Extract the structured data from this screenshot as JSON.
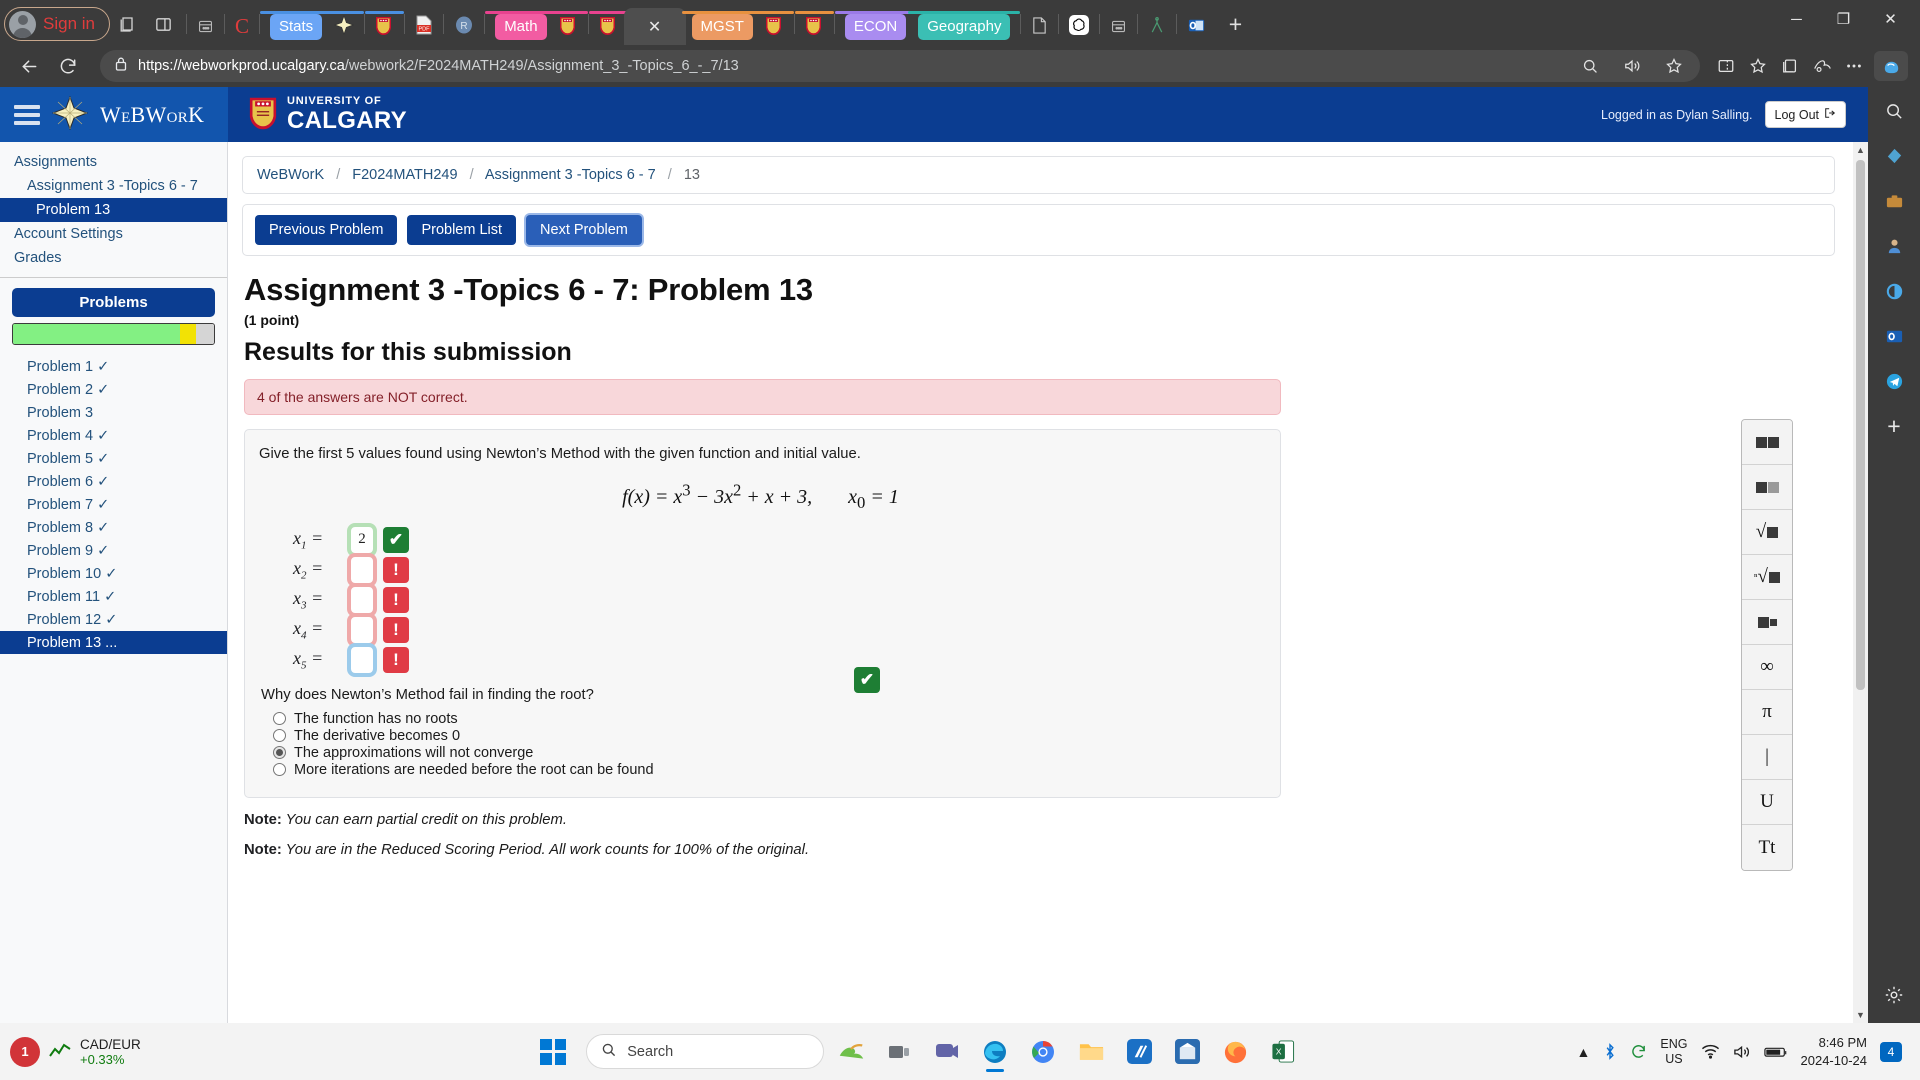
{
  "browser": {
    "profile": {
      "label": "Sign in",
      "icon": "account-avatar-icon"
    },
    "tabs": [
      {
        "name": "tab-collections",
        "type": "icon",
        "icon": "collections-icon",
        "label": ""
      },
      {
        "name": "tab-split",
        "type": "icon",
        "icon": "split-screen-icon",
        "label": ""
      },
      {
        "name": "tab-notes",
        "type": "icon",
        "icon": "document-icon",
        "label": ""
      },
      {
        "name": "tab-c",
        "type": "text",
        "label": "C",
        "color": "#e03c3c",
        "bar": ""
      },
      {
        "name": "tab-stats",
        "type": "chip",
        "label": "Stats",
        "color": "#6ba5f5",
        "bar": "#4a90e2"
      },
      {
        "name": "tab-webwork",
        "type": "icon",
        "icon": "webwork-star-icon",
        "label": "",
        "bar": "#4a90e2"
      },
      {
        "name": "tab-ucalgary-1",
        "type": "icon",
        "icon": "ucalgary-shield-icon",
        "label": "",
        "bar": "#4a90e2"
      },
      {
        "name": "tab-pdf",
        "type": "icon",
        "icon": "pdf-icon",
        "label": ""
      },
      {
        "name": "tab-r",
        "type": "icon",
        "icon": "r-circle-icon",
        "label": ""
      },
      {
        "name": "tab-math",
        "type": "chip",
        "label": "Math",
        "color": "#f25ca2",
        "bar": "#e8428f"
      },
      {
        "name": "tab-ucalgary-2",
        "type": "icon",
        "icon": "ucalgary-shield-icon",
        "label": "",
        "bar": "#e8428f"
      },
      {
        "name": "tab-ucalgary-3",
        "type": "icon",
        "icon": "ucalgary-shield-icon",
        "label": "",
        "bar": "#e8428f"
      },
      {
        "name": "tab-active",
        "type": "active",
        "label": "✕",
        "bar": ""
      },
      {
        "name": "tab-mgst",
        "type": "chip",
        "label": "MGST",
        "color": "#ec9a63",
        "bar": "#e8913f"
      },
      {
        "name": "tab-ucalgary-4",
        "type": "icon",
        "icon": "ucalgary-shield-icon",
        "label": "",
        "bar": "#e8913f"
      },
      {
        "name": "tab-ucalgary-5",
        "type": "icon",
        "icon": "ucalgary-shield-icon",
        "label": "",
        "bar": "#e8913f"
      },
      {
        "name": "tab-econ",
        "type": "chip",
        "label": "ECON",
        "color": "#a98cf0",
        "bar": "#9b7ae8"
      },
      {
        "name": "tab-geography",
        "type": "chip",
        "label": "Geography",
        "color": "#3bbfb4",
        "bar": "#2bb3a8"
      },
      {
        "name": "tab-doc",
        "type": "icon",
        "icon": "page-icon",
        "label": ""
      },
      {
        "name": "tab-chatgpt",
        "type": "icon",
        "icon": "openai-icon",
        "label": ""
      },
      {
        "name": "tab-notes-2",
        "type": "icon",
        "icon": "notes-icon",
        "label": ""
      },
      {
        "name": "tab-compass",
        "type": "icon",
        "icon": "compass-icon",
        "label": ""
      },
      {
        "name": "tab-outlook",
        "type": "icon",
        "icon": "outlook-icon",
        "label": ""
      }
    ],
    "new_tab_label": "+",
    "window_controls": {
      "minimize": "─",
      "maximize": "❐",
      "close": "✕"
    },
    "address": {
      "lock_icon": "lock-icon",
      "url_domain": "https://webworkprod.ucalgary.ca",
      "url_path": "/webwork2/F2024MATH249/Assignment_3_-Topics_6_-_7/13",
      "full_url": "https://webworkprod.ucalgary.ca/webwork2/F2024MATH249/Assignment_3_-Topics_6_-_7/13"
    }
  },
  "header": {
    "brand": "WeBWorK",
    "university_line1": "UNIVERSITY OF",
    "university_line2": "CALGARY",
    "logged_in_as": "Logged in as Dylan Salling.",
    "logout": "Log Out"
  },
  "sidebar": {
    "links": [
      {
        "label": "Assignments",
        "indent": 0,
        "active": false
      },
      {
        "label": "Assignment 3 -Topics 6 - 7",
        "indent": 1,
        "active": false
      },
      {
        "label": "Problem 13",
        "indent": 2,
        "active": true
      },
      {
        "label": "Account Settings",
        "indent": 0,
        "active": false
      },
      {
        "label": "Grades",
        "indent": 0,
        "active": false
      }
    ],
    "problems_header": "Problems",
    "progress": {
      "green_pct": 83,
      "yellow_pct": 8,
      "gray_pct": 9
    },
    "problems": [
      {
        "label": "Problem 1",
        "done": true,
        "active": false
      },
      {
        "label": "Problem 2",
        "done": true,
        "active": false
      },
      {
        "label": "Problem 3",
        "done": false,
        "active": false
      },
      {
        "label": "Problem 4",
        "done": true,
        "active": false
      },
      {
        "label": "Problem 5",
        "done": true,
        "active": false
      },
      {
        "label": "Problem 6",
        "done": true,
        "active": false
      },
      {
        "label": "Problem 7",
        "done": true,
        "active": false
      },
      {
        "label": "Problem 8",
        "done": true,
        "active": false
      },
      {
        "label": "Problem 9",
        "done": true,
        "active": false
      },
      {
        "label": "Problem 10",
        "done": true,
        "active": false
      },
      {
        "label": "Problem 11",
        "done": true,
        "active": false
      },
      {
        "label": "Problem 12",
        "done": true,
        "active": false
      },
      {
        "label": "Problem 13 ...",
        "done": false,
        "active": true
      }
    ],
    "check_glyph": "✓"
  },
  "breadcrumb": {
    "items": [
      "WeBWorK",
      "F2024MATH249",
      "Assignment 3 -Topics 6 - 7",
      "13"
    ],
    "separator": "/"
  },
  "nav_buttons": {
    "previous": "Previous Problem",
    "list": "Problem List",
    "next": "Next Problem"
  },
  "main": {
    "title": "Assignment 3 -Topics 6 - 7: Problem 13",
    "points": "(1 point)",
    "results_heading": "Results for this submission",
    "alert": "4 of the answers are NOT correct.",
    "prompt": "Give the first 5 values found using Newton’s Method with the given function and initial value.",
    "formula": "f(x) = x³ − 3x² + x + 3,  x₀ = 1",
    "answers": [
      {
        "var": "x₁",
        "value": "2",
        "state": "correct",
        "badge": "✔"
      },
      {
        "var": "x₂",
        "value": "",
        "state": "incorrect",
        "badge": "!"
      },
      {
        "var": "x₃",
        "value": "",
        "state": "incorrect",
        "badge": "!"
      },
      {
        "var": "x₄",
        "value": "",
        "state": "incorrect",
        "badge": "!"
      },
      {
        "var": "x₅",
        "value": "",
        "state": "focused",
        "badge": "!"
      }
    ],
    "question": "Why does Newton’s Method fail in finding the root?",
    "options": [
      {
        "label": "The function has no roots",
        "checked": false
      },
      {
        "label": "The derivative becomes 0",
        "checked": false
      },
      {
        "label": "The approximations will not converge",
        "checked": true
      },
      {
        "label": "More iterations are needed before the root can be found",
        "checked": false
      }
    ],
    "option_badge": "✔",
    "notes": [
      {
        "bold": "Note:",
        "text": " You can earn partial credit on this problem."
      },
      {
        "bold": "Note:",
        "text": " You are in the Reduced Scoring Period. All work counts for 100% of the original."
      }
    ]
  },
  "keypad": {
    "keys": [
      {
        "name": "key-superscript",
        "glyph": "▪▫"
      },
      {
        "name": "key-fraction",
        "glyph": "■□"
      },
      {
        "name": "key-sqrt",
        "glyph": "√■"
      },
      {
        "name": "key-nth-root",
        "glyph": "ⁿ√■"
      },
      {
        "name": "key-power",
        "glyph": "■²"
      },
      {
        "name": "key-infinity",
        "glyph": "∞"
      },
      {
        "name": "key-pi",
        "glyph": "π"
      },
      {
        "name": "key-abs",
        "glyph": "|"
      },
      {
        "name": "key-union",
        "glyph": "U"
      },
      {
        "name": "key-text",
        "glyph": "Tt"
      }
    ]
  },
  "edge_sidebar": {
    "icons": [
      {
        "name": "search-icon",
        "glyph": "⌕"
      },
      {
        "name": "shopping-tag-icon",
        "glyph": "◆"
      },
      {
        "name": "tools-icon",
        "glyph": "▤"
      },
      {
        "name": "games-icon",
        "glyph": "⚈"
      },
      {
        "name": "browser-essentials-icon",
        "glyph": "◔"
      },
      {
        "name": "outlook-icon",
        "glyph": "▣"
      },
      {
        "name": "telegram-icon",
        "glyph": "➤"
      },
      {
        "name": "add-icon",
        "glyph": "+"
      },
      {
        "name": "settings-gear-icon",
        "glyph": "⚙"
      }
    ]
  },
  "taskbar": {
    "stock": {
      "pair": "CAD/EUR",
      "change": "+0.33%",
      "badge": "1"
    },
    "search_placeholder": "Search",
    "apps": [
      {
        "name": "taskbar-start-icon",
        "label": ""
      },
      {
        "name": "taskbar-search",
        "label": "Search"
      },
      {
        "name": "taskbar-widgets-icon",
        "label": ""
      },
      {
        "name": "taskbar-taskview-icon",
        "label": ""
      },
      {
        "name": "taskbar-teams-icon",
        "label": ""
      },
      {
        "name": "taskbar-edge-icon",
        "label": "",
        "active": true
      },
      {
        "name": "taskbar-chrome-icon",
        "label": ""
      },
      {
        "name": "taskbar-explorer-icon",
        "label": ""
      },
      {
        "name": "taskbar-app-icon",
        "label": ""
      },
      {
        "name": "taskbar-store-icon",
        "label": ""
      },
      {
        "name": "taskbar-firefox-icon",
        "label": ""
      },
      {
        "name": "taskbar-excel-icon",
        "label": ""
      }
    ],
    "language": {
      "line1": "ENG",
      "line2": "US"
    },
    "clock": {
      "time": "8:46 PM",
      "date": "2024-10-24"
    },
    "notification_count": "4"
  }
}
